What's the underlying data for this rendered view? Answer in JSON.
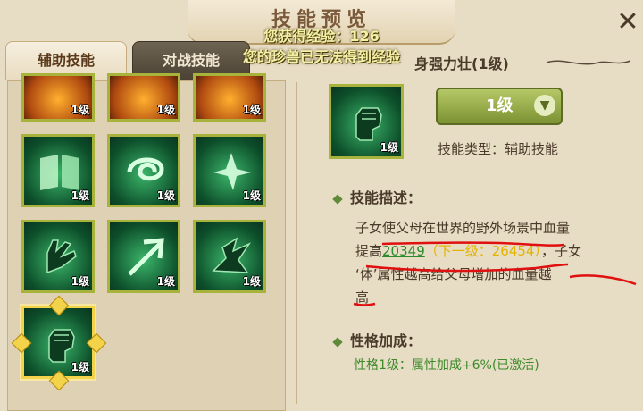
{
  "dialog": {
    "title": "技能预览",
    "close_symbol": "✕"
  },
  "toasts": {
    "line1": "您获得经验：126",
    "line2": "您的珍兽已无法得到经验"
  },
  "tabs": {
    "support_skills": "辅助技能",
    "battle_skills": "对战技能"
  },
  "skill_grid": {
    "level_label": "1级",
    "icons": [
      "monkey-icon",
      "flame-burst-icon",
      "fire-ring-icon",
      "book-icon",
      "whirlwind-icon",
      "wolf-howl-icon",
      "open-hand-icon",
      "arrow-icon",
      "dragon-wing-icon",
      "fist-icon"
    ],
    "selected_icon": "fist-icon"
  },
  "detail": {
    "skill_name": "身强力壮(1级)",
    "level_select": "1级",
    "skill_type_label": "技能类型：",
    "skill_type_value": "辅助技能",
    "desc_heading": "技能描述：",
    "desc_line1": "子女使父母在世界的野外场景中血量",
    "desc_prefix": "提高",
    "desc_value": "20349",
    "desc_next": "（下一级：26454）",
    "desc_suffix": "，子女",
    "desc_line3": "‘体’属性越高给父母增加的血量越",
    "desc_line4": "高",
    "personality_heading": "性格加成：",
    "personality_text": "性格1级：属性加成+6%(已激活)"
  },
  "colors": {
    "background": "#e7dcc4",
    "skill_green": "#1f8a4a",
    "level_button": "#8fa640",
    "annotation_red": "#e01010",
    "highlight_yellow": "#e2b400"
  }
}
